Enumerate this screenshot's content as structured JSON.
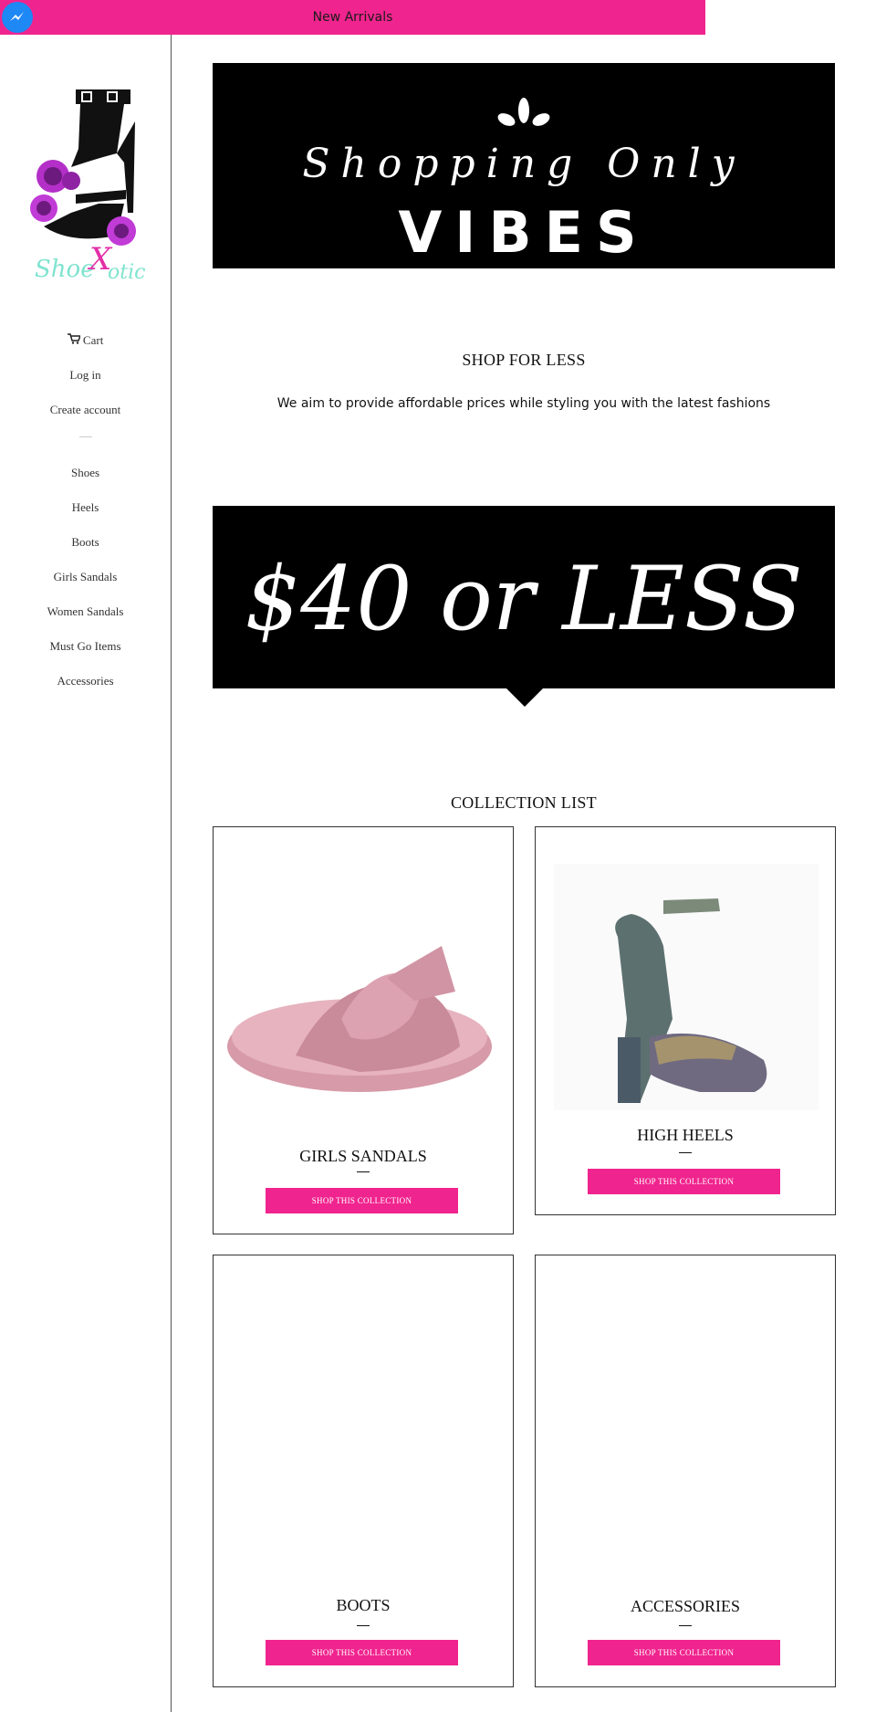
{
  "announcement": {
    "text": "New Arrivals"
  },
  "brand": {
    "logo_text": "ShoeXotic",
    "accent_color": "#f0248e"
  },
  "sidebar": {
    "account_items": [
      {
        "label": "Cart",
        "icon": "cart-icon"
      },
      {
        "label": "Log in"
      },
      {
        "label": "Create account"
      }
    ],
    "items": [
      {
        "label": "Shoes"
      },
      {
        "label": "Heels"
      },
      {
        "label": "Boots"
      },
      {
        "label": "Girls Sandals"
      },
      {
        "label": "Women Sandals"
      },
      {
        "label": "Must Go Items"
      },
      {
        "label": "Accessories"
      }
    ]
  },
  "banner_top": {
    "line1": "Shopping Only",
    "line2": "VIBES"
  },
  "intro": {
    "title": "SHOP FOR LESS",
    "subtitle": "We aim to provide affordable prices while styling you with the latest fashions"
  },
  "banner_price": {
    "text": "$40 or LESS"
  },
  "collections": {
    "title": "COLLECTION LIST",
    "button_label": "SHOP THIS COLLECTION",
    "items": [
      {
        "title": "GIRLS SANDALS"
      },
      {
        "title": "HIGH HEELS"
      },
      {
        "title": "BOOTS"
      },
      {
        "title": "ACCESSORIES"
      }
    ]
  }
}
